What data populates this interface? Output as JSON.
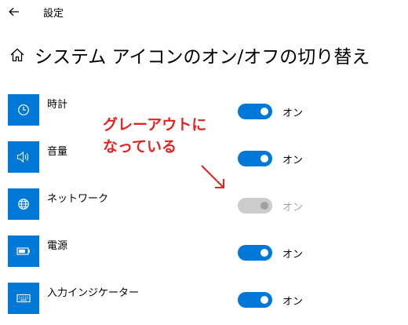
{
  "topbar": {
    "back_icon": "back-arrow-icon",
    "title": "設定"
  },
  "header": {
    "home_icon": "home-icon",
    "title": "システム アイコンのオン/オフの切り替え"
  },
  "rows": [
    {
      "label": "時計",
      "icon": "clock-icon",
      "state": "オン",
      "enabled": true,
      "on": true
    },
    {
      "label": "音量",
      "icon": "speaker-icon",
      "state": "オン",
      "enabled": true,
      "on": true
    },
    {
      "label": "ネットワーク",
      "icon": "globe-icon",
      "state": "オン",
      "enabled": false,
      "on": true
    },
    {
      "label": "電源",
      "icon": "battery-icon",
      "state": "オン",
      "enabled": true,
      "on": true
    },
    {
      "label": "入力インジケーター",
      "icon": "keyboard-icon",
      "state": "オン",
      "enabled": true,
      "on": true
    }
  ],
  "annotation": {
    "line1": "グレーアウトに",
    "line2": "なっている",
    "color": "#e52421"
  },
  "colors": {
    "accent": "#0078d7",
    "toggle_disabled": "#cccccc",
    "text_disabled": "#a6a6a6"
  }
}
